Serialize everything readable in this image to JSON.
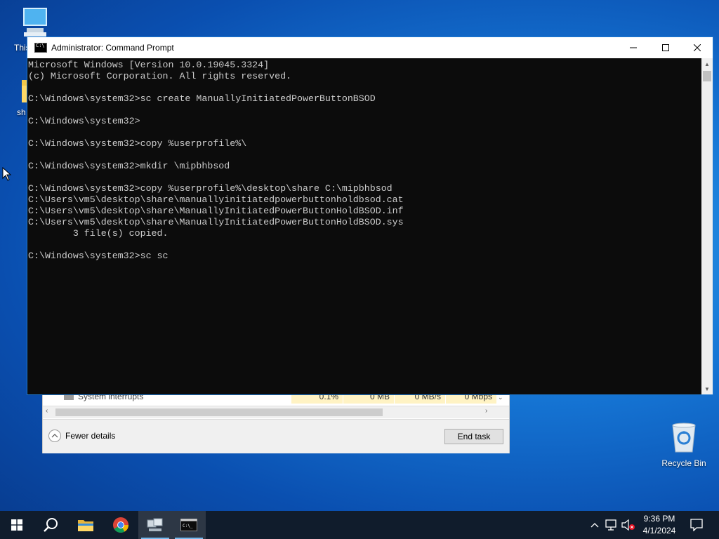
{
  "desktop": {
    "icons": [
      {
        "label": "This",
        "icon": "this-pc-icon"
      },
      {
        "label": "sh",
        "icon": "folder-icon"
      },
      {
        "label": "Recycle Bin",
        "icon": "recycle-bin-icon"
      }
    ]
  },
  "taskmgr": {
    "process_row": {
      "name": "System interrupts",
      "cpu": "0.1%",
      "memory": "0 MB",
      "disk": "0 MB/s",
      "network": "0 Mbps"
    },
    "fewer_details_label": "Fewer details",
    "end_task_label": "End task"
  },
  "cmd": {
    "title": "Administrator: Command Prompt",
    "lines": [
      "Microsoft Windows [Version 10.0.19045.3324]",
      "(c) Microsoft Corporation. All rights reserved.",
      "",
      "C:\\Windows\\system32>sc create ManuallyInitiatedPowerButtonBSOD",
      "",
      "C:\\Windows\\system32>",
      "",
      "C:\\Windows\\system32>copy %userprofile%\\",
      "",
      "C:\\Windows\\system32>mkdir \\mipbhbsod",
      "",
      "C:\\Windows\\system32>copy %userprofile%\\desktop\\share C:\\mipbhbsod",
      "C:\\Users\\vm5\\desktop\\share\\manuallyinitiatedpowerbuttonholdbsod.cat",
      "C:\\Users\\vm5\\desktop\\share\\ManuallyInitiatedPowerButtonHoldBSOD.inf",
      "C:\\Users\\vm5\\desktop\\share\\ManuallyInitiatedPowerButtonHoldBSOD.sys",
      "        3 file(s) copied.",
      "",
      "C:\\Windows\\system32>sc sc"
    ]
  },
  "taskbar": {
    "clock_time": "9:36 PM",
    "clock_date": "4/1/2024"
  }
}
